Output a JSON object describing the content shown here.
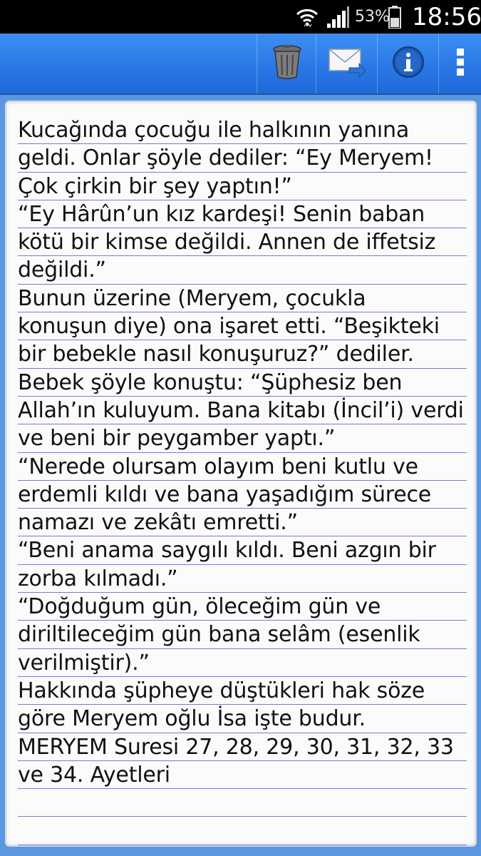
{
  "status_bar": {
    "battery_percent": "53%",
    "time": "18:56",
    "icons": [
      "wifi-icon",
      "signal-icon",
      "battery-icon"
    ]
  },
  "action_bar": {
    "buttons": [
      {
        "icon": "trash-icon"
      },
      {
        "icon": "mail-icon"
      },
      {
        "icon": "info-icon"
      },
      {
        "icon": "overflow-menu-icon"
      }
    ]
  },
  "note": {
    "lines": [
      "Kucağında çocuğu ile halkının yanına",
      "geldi. Onlar şöyle dediler: “Ey Meryem!",
      "Çok çirkin bir şey yaptın!”",
      "“Ey Hârûn’un kız kardeşi! Senin baban",
      "kötü bir kimse değildi. Annen de iffetsiz",
      "değildi.”",
      "Bunun üzerine (Meryem, çocukla",
      "konuşun diye) ona işaret etti. “Beşikteki",
      "bir bebekle nasıl konuşuruz?” dediler.",
      "Bebek şöyle konuştu: “Şüphesiz ben",
      "Allah’ın kuluyum. Bana kitabı (İncil’i) verdi",
      "ve beni bir peygamber yaptı.”",
      "“Nerede olursam olayım beni kutlu ve",
      "erdemli kıldı ve bana yaşadığım sürece",
      "namazı ve zekâtı emretti.”",
      "“Beni anama saygılı kıldı. Beni azgın bir",
      "zorba kılmadı.”",
      "“Doğduğum gün, öleceğim gün ve",
      "diriltileceğim gün bana selâm (esenlik",
      "verilmiştir).”",
      "Hakkında şüpheye düştükleri hak söze",
      "göre Meryem oğlu İsa işte budur.",
      "MERYEM Suresi 27, 28, 29, 30, 31, 32, 33",
      "ve 34. Ayetleri",
      "",
      ""
    ]
  },
  "colors": {
    "action_bar": "#2a78e6",
    "rule_line": "#6f7fd8",
    "paper": "#fbfbfa"
  }
}
